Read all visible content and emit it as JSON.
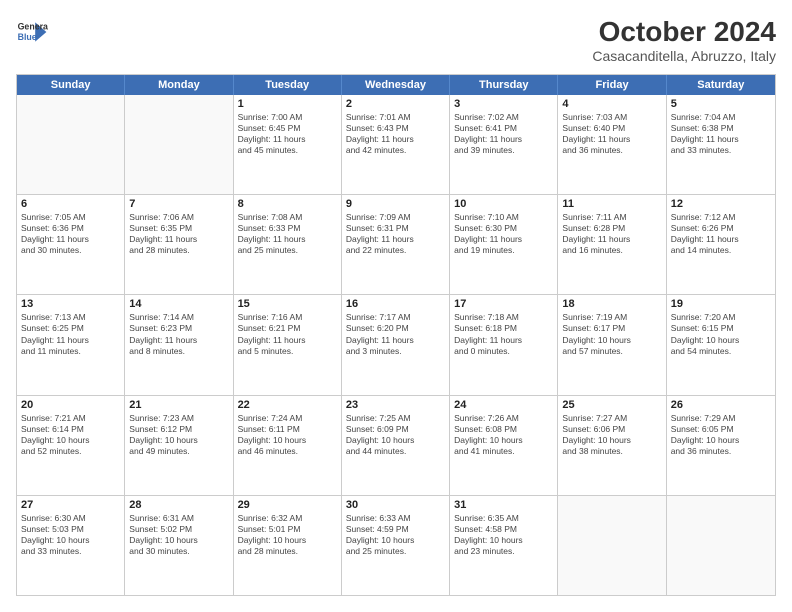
{
  "logo": {
    "line1": "General",
    "line2": "Blue"
  },
  "title": "October 2024",
  "subtitle": "Casacanditella, Abruzzo, Italy",
  "weekdays": [
    "Sunday",
    "Monday",
    "Tuesday",
    "Wednesday",
    "Thursday",
    "Friday",
    "Saturday"
  ],
  "weeks": [
    [
      {
        "day": "",
        "lines": [],
        "empty": true
      },
      {
        "day": "",
        "lines": [],
        "empty": true
      },
      {
        "day": "1",
        "lines": [
          "Sunrise: 7:00 AM",
          "Sunset: 6:45 PM",
          "Daylight: 11 hours",
          "and 45 minutes."
        ]
      },
      {
        "day": "2",
        "lines": [
          "Sunrise: 7:01 AM",
          "Sunset: 6:43 PM",
          "Daylight: 11 hours",
          "and 42 minutes."
        ]
      },
      {
        "day": "3",
        "lines": [
          "Sunrise: 7:02 AM",
          "Sunset: 6:41 PM",
          "Daylight: 11 hours",
          "and 39 minutes."
        ]
      },
      {
        "day": "4",
        "lines": [
          "Sunrise: 7:03 AM",
          "Sunset: 6:40 PM",
          "Daylight: 11 hours",
          "and 36 minutes."
        ]
      },
      {
        "day": "5",
        "lines": [
          "Sunrise: 7:04 AM",
          "Sunset: 6:38 PM",
          "Daylight: 11 hours",
          "and 33 minutes."
        ]
      }
    ],
    [
      {
        "day": "6",
        "lines": [
          "Sunrise: 7:05 AM",
          "Sunset: 6:36 PM",
          "Daylight: 11 hours",
          "and 30 minutes."
        ]
      },
      {
        "day": "7",
        "lines": [
          "Sunrise: 7:06 AM",
          "Sunset: 6:35 PM",
          "Daylight: 11 hours",
          "and 28 minutes."
        ]
      },
      {
        "day": "8",
        "lines": [
          "Sunrise: 7:08 AM",
          "Sunset: 6:33 PM",
          "Daylight: 11 hours",
          "and 25 minutes."
        ]
      },
      {
        "day": "9",
        "lines": [
          "Sunrise: 7:09 AM",
          "Sunset: 6:31 PM",
          "Daylight: 11 hours",
          "and 22 minutes."
        ]
      },
      {
        "day": "10",
        "lines": [
          "Sunrise: 7:10 AM",
          "Sunset: 6:30 PM",
          "Daylight: 11 hours",
          "and 19 minutes."
        ]
      },
      {
        "day": "11",
        "lines": [
          "Sunrise: 7:11 AM",
          "Sunset: 6:28 PM",
          "Daylight: 11 hours",
          "and 16 minutes."
        ]
      },
      {
        "day": "12",
        "lines": [
          "Sunrise: 7:12 AM",
          "Sunset: 6:26 PM",
          "Daylight: 11 hours",
          "and 14 minutes."
        ]
      }
    ],
    [
      {
        "day": "13",
        "lines": [
          "Sunrise: 7:13 AM",
          "Sunset: 6:25 PM",
          "Daylight: 11 hours",
          "and 11 minutes."
        ]
      },
      {
        "day": "14",
        "lines": [
          "Sunrise: 7:14 AM",
          "Sunset: 6:23 PM",
          "Daylight: 11 hours",
          "and 8 minutes."
        ]
      },
      {
        "day": "15",
        "lines": [
          "Sunrise: 7:16 AM",
          "Sunset: 6:21 PM",
          "Daylight: 11 hours",
          "and 5 minutes."
        ]
      },
      {
        "day": "16",
        "lines": [
          "Sunrise: 7:17 AM",
          "Sunset: 6:20 PM",
          "Daylight: 11 hours",
          "and 3 minutes."
        ]
      },
      {
        "day": "17",
        "lines": [
          "Sunrise: 7:18 AM",
          "Sunset: 6:18 PM",
          "Daylight: 11 hours",
          "and 0 minutes."
        ]
      },
      {
        "day": "18",
        "lines": [
          "Sunrise: 7:19 AM",
          "Sunset: 6:17 PM",
          "Daylight: 10 hours",
          "and 57 minutes."
        ]
      },
      {
        "day": "19",
        "lines": [
          "Sunrise: 7:20 AM",
          "Sunset: 6:15 PM",
          "Daylight: 10 hours",
          "and 54 minutes."
        ]
      }
    ],
    [
      {
        "day": "20",
        "lines": [
          "Sunrise: 7:21 AM",
          "Sunset: 6:14 PM",
          "Daylight: 10 hours",
          "and 52 minutes."
        ]
      },
      {
        "day": "21",
        "lines": [
          "Sunrise: 7:23 AM",
          "Sunset: 6:12 PM",
          "Daylight: 10 hours",
          "and 49 minutes."
        ]
      },
      {
        "day": "22",
        "lines": [
          "Sunrise: 7:24 AM",
          "Sunset: 6:11 PM",
          "Daylight: 10 hours",
          "and 46 minutes."
        ]
      },
      {
        "day": "23",
        "lines": [
          "Sunrise: 7:25 AM",
          "Sunset: 6:09 PM",
          "Daylight: 10 hours",
          "and 44 minutes."
        ]
      },
      {
        "day": "24",
        "lines": [
          "Sunrise: 7:26 AM",
          "Sunset: 6:08 PM",
          "Daylight: 10 hours",
          "and 41 minutes."
        ]
      },
      {
        "day": "25",
        "lines": [
          "Sunrise: 7:27 AM",
          "Sunset: 6:06 PM",
          "Daylight: 10 hours",
          "and 38 minutes."
        ]
      },
      {
        "day": "26",
        "lines": [
          "Sunrise: 7:29 AM",
          "Sunset: 6:05 PM",
          "Daylight: 10 hours",
          "and 36 minutes."
        ]
      }
    ],
    [
      {
        "day": "27",
        "lines": [
          "Sunrise: 6:30 AM",
          "Sunset: 5:03 PM",
          "Daylight: 10 hours",
          "and 33 minutes."
        ]
      },
      {
        "day": "28",
        "lines": [
          "Sunrise: 6:31 AM",
          "Sunset: 5:02 PM",
          "Daylight: 10 hours",
          "and 30 minutes."
        ]
      },
      {
        "day": "29",
        "lines": [
          "Sunrise: 6:32 AM",
          "Sunset: 5:01 PM",
          "Daylight: 10 hours",
          "and 28 minutes."
        ]
      },
      {
        "day": "30",
        "lines": [
          "Sunrise: 6:33 AM",
          "Sunset: 4:59 PM",
          "Daylight: 10 hours",
          "and 25 minutes."
        ]
      },
      {
        "day": "31",
        "lines": [
          "Sunrise: 6:35 AM",
          "Sunset: 4:58 PM",
          "Daylight: 10 hours",
          "and 23 minutes."
        ]
      },
      {
        "day": "",
        "lines": [],
        "empty": true
      },
      {
        "day": "",
        "lines": [],
        "empty": true
      }
    ]
  ]
}
